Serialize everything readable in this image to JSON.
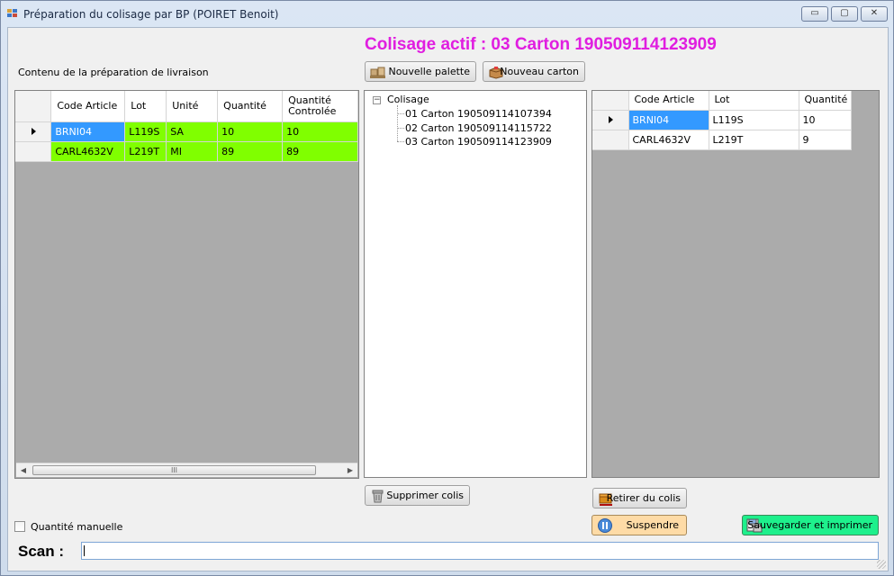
{
  "window": {
    "title": "Préparation du colisage par BP (POIRET Benoit)",
    "controls": {
      "minimize": "▭",
      "maximize": "▢",
      "close": "✕"
    }
  },
  "active_package": "Colisage actif : 03 Carton 190509114123909",
  "left_panel": {
    "label": "Contenu de la préparation de livraison",
    "columns": [
      "Code Article",
      "Lot",
      "Unité",
      "Quantité",
      "Quantité Controlée"
    ],
    "rows": [
      {
        "code": "BRNI04",
        "lot": "L119S",
        "unite": "SA",
        "quantite": "10",
        "controlee": "10"
      },
      {
        "code": "CARL4632V",
        "lot": "L219T",
        "unite": "MI",
        "quantite": "89",
        "controlee": "89"
      }
    ],
    "row_color": "#80ff00",
    "scrollbar_grip": "III"
  },
  "buttons": {
    "new_pallet": "Nouvelle palette",
    "new_carton": "Nouveau carton",
    "delete_package": "Supprimer colis",
    "remove_from_package": "Retirer du colis",
    "suspend": "Suspendre",
    "save_print": "Sauvegarder et imprimer"
  },
  "tree": {
    "root": "Colisage",
    "children": [
      "01 Carton 190509114107394",
      "02 Carton 190509114115722",
      "03 Carton 190509114123909"
    ]
  },
  "right_panel": {
    "columns": [
      "Code Article",
      "Lot",
      "Quantité"
    ],
    "rows": [
      {
        "code": "BRNI04",
        "lot": "L119S",
        "quantite": "10"
      },
      {
        "code": "CARL4632V",
        "lot": "L219T",
        "quantite": "9"
      }
    ]
  },
  "manual_quantity_label": "Quantité manuelle",
  "scan": {
    "label": "Scan :",
    "value": ""
  },
  "colors": {
    "banner": "#e01ee0",
    "selection": "#3399ff",
    "suspend_bg": "#fedba6",
    "save_bg": "#1ef08c"
  },
  "icons": {
    "new_pallet": "pallet-icon",
    "new_carton": "carton-icon",
    "delete_package": "trash-icon",
    "remove_from_package": "remove-box-icon",
    "suspend": "pause-icon",
    "save_print": "save-print-icon"
  }
}
